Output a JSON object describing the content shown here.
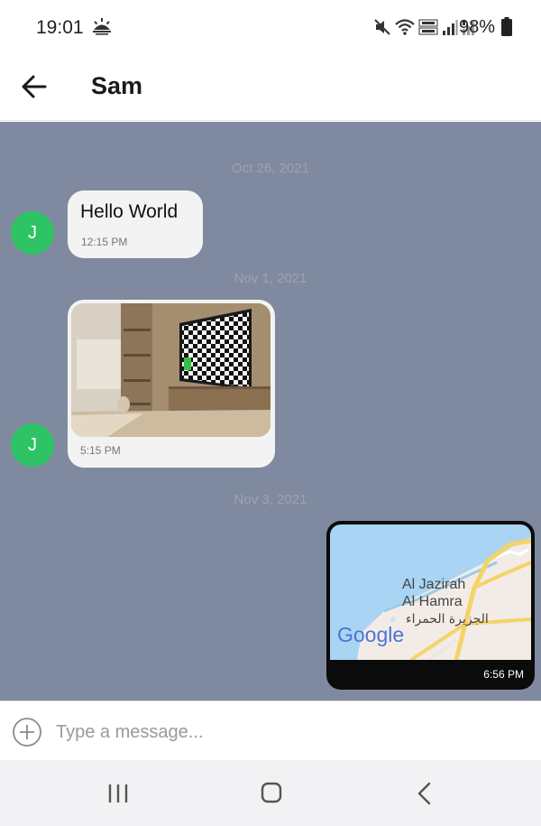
{
  "status_bar": {
    "time": "19:01",
    "battery": "98%",
    "icons": [
      "weather-icon",
      "mute-icon",
      "wifi-icon",
      "volte-icon",
      "signal-icon",
      "signal-icon-2",
      "battery-icon"
    ]
  },
  "app_bar": {
    "title": "Sam",
    "back_icon": "arrow-left-icon"
  },
  "messages": [
    {
      "date": "Oct 26, 2021",
      "type": "text",
      "sender": "incoming",
      "avatar": "J",
      "text": "Hello World",
      "time": "12:15 PM"
    },
    {
      "date": "Nov 1, 2021",
      "type": "image",
      "sender": "incoming",
      "avatar": "J",
      "time": "5:15 PM"
    },
    {
      "date": "Nov 3, 2021",
      "type": "location",
      "sender": "outgoing",
      "time": "6:56 PM",
      "map_labels": {
        "en_line1": "Al Jazirah",
        "en_line2": "Al Hamra",
        "ar": "الجزيرة الحمراء",
        "logo": "Google"
      }
    }
  ],
  "composer": {
    "placeholder": "Type a message...",
    "value": ""
  },
  "colors": {
    "chat_background": "#7f8aa0",
    "avatar": "#2ec365",
    "bubble": "#f3f3f3"
  }
}
